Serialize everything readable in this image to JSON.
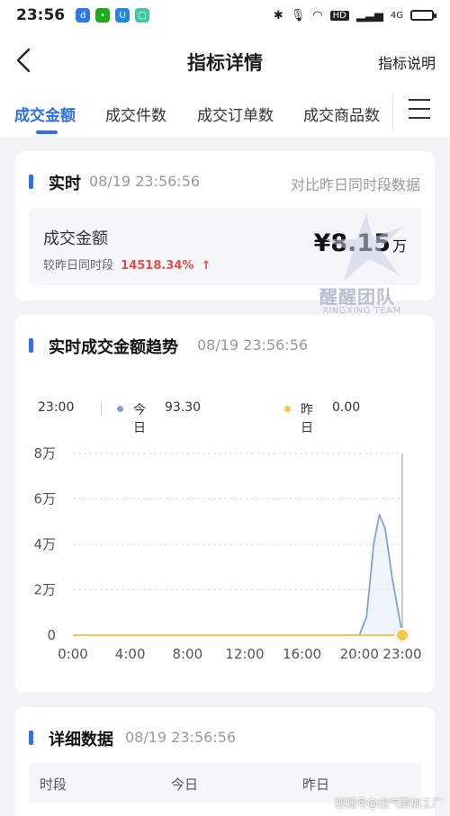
{
  "status_bar": {
    "time": "23:56",
    "network_label": "HD",
    "signal_label": "4G"
  },
  "nav": {
    "title": "指标详情",
    "right_link": "指标说明"
  },
  "tabs": [
    {
      "label": "成交金额",
      "active": true
    },
    {
      "label": "成交件数",
      "active": false
    },
    {
      "label": "成交订单数",
      "active": false
    },
    {
      "label": "成交商品数",
      "active": false
    }
  ],
  "realtime": {
    "title": "实时",
    "timestamp": "08/19 23:56:56",
    "compare_link": "对比昨日同时段数据",
    "metric_label": "成交金额",
    "compare_label": "较昨日同时段",
    "compare_pct": "14518.34%",
    "value_prefix": "¥",
    "value": "8.15",
    "value_unit": "万"
  },
  "watermark": {
    "text": "醒醒团队",
    "sub": "XINGXING TEAM"
  },
  "trend": {
    "title": "实时成交金额趋势",
    "timestamp": "08/19 23:56:56",
    "legend_time": "23:00",
    "legend_today_label": "今日",
    "legend_today_value": "93.30",
    "legend_yesterday_label": "昨日",
    "legend_yesterday_value": "0.00"
  },
  "chart_data": {
    "type": "line",
    "x": [
      "0:00",
      "4:00",
      "8:00",
      "12:00",
      "16:00",
      "20:00",
      "23:00"
    ],
    "x_ticks": [
      "0:00",
      "4:00",
      "8:00",
      "12:00",
      "16:00",
      "20:00",
      "23:00"
    ],
    "y_ticks": [
      "0",
      "2万",
      "4万",
      "6万",
      "8万"
    ],
    "ylim": [
      0,
      80000
    ],
    "series": [
      {
        "name": "今日",
        "color": "#7fa3d6",
        "points": [
          [
            0,
            0
          ],
          [
            20,
            0
          ],
          [
            20.5,
            8000
          ],
          [
            21,
            40000
          ],
          [
            21.4,
            53000
          ],
          [
            21.8,
            47000
          ],
          [
            22.3,
            25000
          ],
          [
            23,
            300
          ]
        ]
      },
      {
        "name": "昨日",
        "color": "#f2c94c",
        "points": [
          [
            0,
            0
          ],
          [
            23,
            0
          ]
        ]
      }
    ],
    "grid": true,
    "cursor_hour": 23
  },
  "details": {
    "title": "详细数据",
    "timestamp": "08/19 23:56:56",
    "columns": [
      "时段",
      "今日",
      "昨日"
    ]
  },
  "footer_watermark": "搜狐号@出气筒加工厂",
  "colors": {
    "accent": "#2f6fe8",
    "up": "#e84d4d",
    "today_line": "#7fa3d6",
    "yesterday_line": "#f2c94c"
  }
}
